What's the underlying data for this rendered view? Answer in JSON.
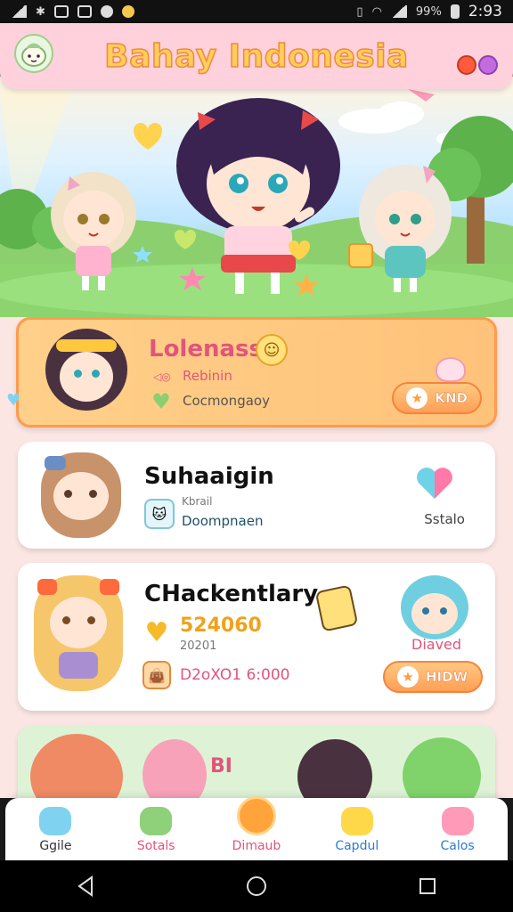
{
  "status_bar": {
    "battery": "99%",
    "time": "2:93"
  },
  "app_bar": {
    "title": "Bahay Indonesia"
  },
  "featured_card": {
    "title": "Lolenass",
    "line1": "Rebinin",
    "line2": "Cocmongaoy",
    "button_label": "KND"
  },
  "card2": {
    "title": "Suhaaigin",
    "line1": "Kbrail",
    "line2": "Doompnaen",
    "side_label": "Sstalo"
  },
  "card3": {
    "title": "CHackentlary",
    "stat_big": "524060",
    "stat_small": "20201",
    "stat_line": "D2oXO1 6:000",
    "side_label": "Diaved",
    "button_label": "HIDW"
  },
  "card4": {
    "label": "BI"
  },
  "bottom_nav": {
    "items": [
      {
        "label": "Ggile",
        "color": "#333333"
      },
      {
        "label": "Sotals",
        "color": "#e0557a"
      },
      {
        "label": "Dimaub",
        "color": "#e0557a"
      },
      {
        "label": "Capdul",
        "color": "#2b7bd3"
      },
      {
        "label": "Calos",
        "color": "#2b7bd3"
      }
    ]
  },
  "colors": {
    "accent": "#ff9b4e",
    "pink": "#ffd1dc",
    "title_fill": "#ffce5c"
  }
}
